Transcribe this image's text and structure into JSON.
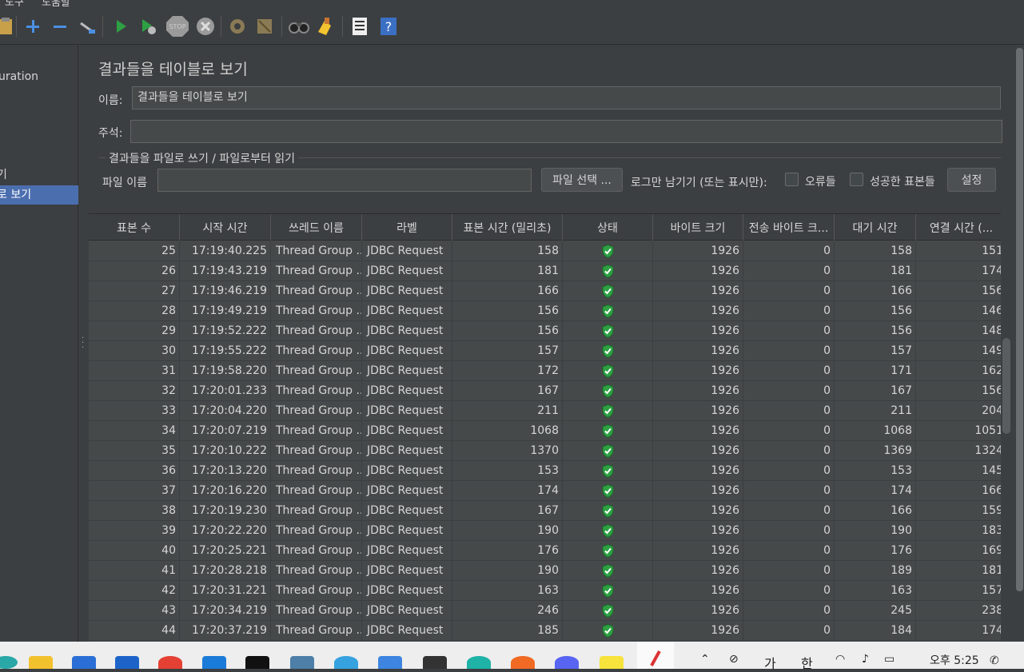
{
  "menu": {
    "item1": "도구",
    "item2": "도움말"
  },
  "toolbar": {
    "icons": [
      "clipboard-icon",
      "add-icon",
      "remove-icon",
      "toggle-icon",
      "start-icon",
      "start-no-pause-icon",
      "stop-icon",
      "shutdown-icon",
      "clear-icon",
      "clear-all-icon",
      "search-icon",
      "reset-search-icon",
      "function-helper-icon",
      "help-icon"
    ]
  },
  "sidebar": {
    "items": [
      {
        "label": "uration"
      },
      {
        "label": "기"
      },
      {
        "label": "로 보기"
      }
    ]
  },
  "panel": {
    "title": "결과들을 테이블로 보기",
    "name_label": "이름:",
    "name_value": "결과들을 테이블로 보기",
    "comment_label": "주석:",
    "comment_value": "",
    "file_group_title": "결과들을 파일로 쓰기 / 파일로부터 읽기",
    "file_name_label": "파일 이름",
    "file_name_value": "",
    "browse_button": "파일 선택 ...",
    "log_only_label": "로그만 남기기 (또는 표시만):",
    "errors_label": "오류들",
    "success_label": "성공한 표본들",
    "settings_button": "설정"
  },
  "table": {
    "columns": [
      "표본 수",
      "시작 시간",
      "쓰레드 이름",
      "라벨",
      "표본 시간 (밀리초)",
      "상태",
      "바이트 크기",
      "전송 바이트 크...",
      "대기 시간",
      "연결 시간 (..."
    ],
    "rows": [
      {
        "n": "25",
        "start": "17:19:40.225",
        "thread": "Thread Group ...",
        "label": "JDBC Request",
        "time": "158",
        "bytes": "1926",
        "sent": "0",
        "latency": "158",
        "connect": "151"
      },
      {
        "n": "26",
        "start": "17:19:43.219",
        "thread": "Thread Group ...",
        "label": "JDBC Request",
        "time": "181",
        "bytes": "1926",
        "sent": "0",
        "latency": "181",
        "connect": "174"
      },
      {
        "n": "27",
        "start": "17:19:46.219",
        "thread": "Thread Group ...",
        "label": "JDBC Request",
        "time": "166",
        "bytes": "1926",
        "sent": "0",
        "latency": "166",
        "connect": "156"
      },
      {
        "n": "28",
        "start": "17:19:49.219",
        "thread": "Thread Group ...",
        "label": "JDBC Request",
        "time": "156",
        "bytes": "1926",
        "sent": "0",
        "latency": "156",
        "connect": "146"
      },
      {
        "n": "29",
        "start": "17:19:52.222",
        "thread": "Thread Group ...",
        "label": "JDBC Request",
        "time": "156",
        "bytes": "1926",
        "sent": "0",
        "latency": "156",
        "connect": "148"
      },
      {
        "n": "30",
        "start": "17:19:55.222",
        "thread": "Thread Group ...",
        "label": "JDBC Request",
        "time": "157",
        "bytes": "1926",
        "sent": "0",
        "latency": "157",
        "connect": "149"
      },
      {
        "n": "31",
        "start": "17:19:58.220",
        "thread": "Thread Group ...",
        "label": "JDBC Request",
        "time": "172",
        "bytes": "1926",
        "sent": "0",
        "latency": "171",
        "connect": "162"
      },
      {
        "n": "32",
        "start": "17:20:01.233",
        "thread": "Thread Group ...",
        "label": "JDBC Request",
        "time": "167",
        "bytes": "1926",
        "sent": "0",
        "latency": "167",
        "connect": "156"
      },
      {
        "n": "33",
        "start": "17:20:04.220",
        "thread": "Thread Group ...",
        "label": "JDBC Request",
        "time": "211",
        "bytes": "1926",
        "sent": "0",
        "latency": "211",
        "connect": "204"
      },
      {
        "n": "34",
        "start": "17:20:07.219",
        "thread": "Thread Group ...",
        "label": "JDBC Request",
        "time": "1068",
        "bytes": "1926",
        "sent": "0",
        "latency": "1068",
        "connect": "1051"
      },
      {
        "n": "35",
        "start": "17:20:10.222",
        "thread": "Thread Group ...",
        "label": "JDBC Request",
        "time": "1370",
        "bytes": "1926",
        "sent": "0",
        "latency": "1369",
        "connect": "1324"
      },
      {
        "n": "36",
        "start": "17:20:13.220",
        "thread": "Thread Group ...",
        "label": "JDBC Request",
        "time": "153",
        "bytes": "1926",
        "sent": "0",
        "latency": "153",
        "connect": "145"
      },
      {
        "n": "37",
        "start": "17:20:16.220",
        "thread": "Thread Group ...",
        "label": "JDBC Request",
        "time": "174",
        "bytes": "1926",
        "sent": "0",
        "latency": "174",
        "connect": "166"
      },
      {
        "n": "38",
        "start": "17:20:19.230",
        "thread": "Thread Group ...",
        "label": "JDBC Request",
        "time": "167",
        "bytes": "1926",
        "sent": "0",
        "latency": "166",
        "connect": "159"
      },
      {
        "n": "39",
        "start": "17:20:22.220",
        "thread": "Thread Group ...",
        "label": "JDBC Request",
        "time": "190",
        "bytes": "1926",
        "sent": "0",
        "latency": "190",
        "connect": "183"
      },
      {
        "n": "40",
        "start": "17:20:25.221",
        "thread": "Thread Group ...",
        "label": "JDBC Request",
        "time": "176",
        "bytes": "1926",
        "sent": "0",
        "latency": "176",
        "connect": "169"
      },
      {
        "n": "41",
        "start": "17:20:28.218",
        "thread": "Thread Group ...",
        "label": "JDBC Request",
        "time": "190",
        "bytes": "1926",
        "sent": "0",
        "latency": "189",
        "connect": "181"
      },
      {
        "n": "42",
        "start": "17:20:31.221",
        "thread": "Thread Group ...",
        "label": "JDBC Request",
        "time": "163",
        "bytes": "1926",
        "sent": "0",
        "latency": "163",
        "connect": "157"
      },
      {
        "n": "43",
        "start": "17:20:34.219",
        "thread": "Thread Group ...",
        "label": "JDBC Request",
        "time": "246",
        "bytes": "1926",
        "sent": "0",
        "latency": "245",
        "connect": "238"
      },
      {
        "n": "44",
        "start": "17:20:37.219",
        "thread": "Thread Group ...",
        "label": "JDBC Request",
        "time": "185",
        "bytes": "1926",
        "sent": "0",
        "latency": "184",
        "connect": "174"
      }
    ]
  },
  "taskbar": {
    "tray_text_1": "가",
    "tray_text_2": "한",
    "clock": "오후 5:25"
  },
  "colors": {
    "background": "#3c3f41",
    "selection": "#4b6eaf",
    "table_bg": "#45494a",
    "success_green": "#2ea043"
  }
}
